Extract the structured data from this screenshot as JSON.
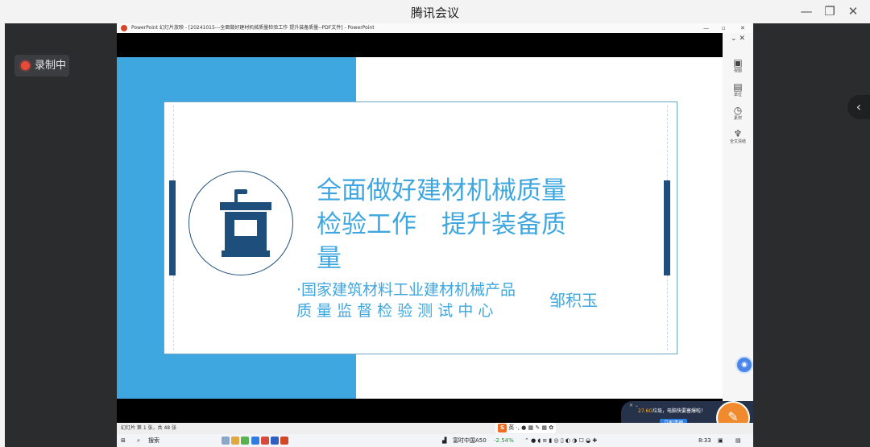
{
  "window": {
    "title": "腾讯会议",
    "controls": {
      "minimize": "—",
      "restore": "❐",
      "close": "✕"
    }
  },
  "recording": {
    "label": "录制中"
  },
  "ppt": {
    "window_title": "PowerPoint 幻灯片放映 - [20241015---全面做好建材机械质量检验工作 提升装备质量--PDF文件] - PowerPoint",
    "controls": {
      "minimize": "—",
      "restore": "▫",
      "close": "✕"
    },
    "slide": {
      "title": "全面做好建材机械质量检验工作　提升装备质量",
      "org_line1": "·国家建筑材料工业建材机械产品",
      "org_line2": "质 量 监 督 检 验 测 试 中 心",
      "author": "邹积玉"
    },
    "status": "幻灯片 第 1 张，共 48 张",
    "panel_items": [
      {
        "label": "视图",
        "icon": "screen-icon"
      },
      {
        "label": "单位",
        "icon": "window-icon"
      },
      {
        "label": "素材",
        "icon": "clock-icon"
      },
      {
        "label": "全文清结",
        "icon": "broom-icon"
      }
    ]
  },
  "notification": {
    "size": "27.6G",
    "text": "垃圾，电脑快要塞爆啦！",
    "button": "立即清理"
  },
  "ime": {
    "lang": "英"
  },
  "taskbar": {
    "search": "搜索",
    "stock_name": "富时中国A50",
    "stock_change": "-2.54%",
    "time": "8:33"
  },
  "colors": {
    "slide_blue": "#3fa7e0",
    "slide_navy": "#1e4f7c",
    "record_red": "#e84a3a"
  }
}
